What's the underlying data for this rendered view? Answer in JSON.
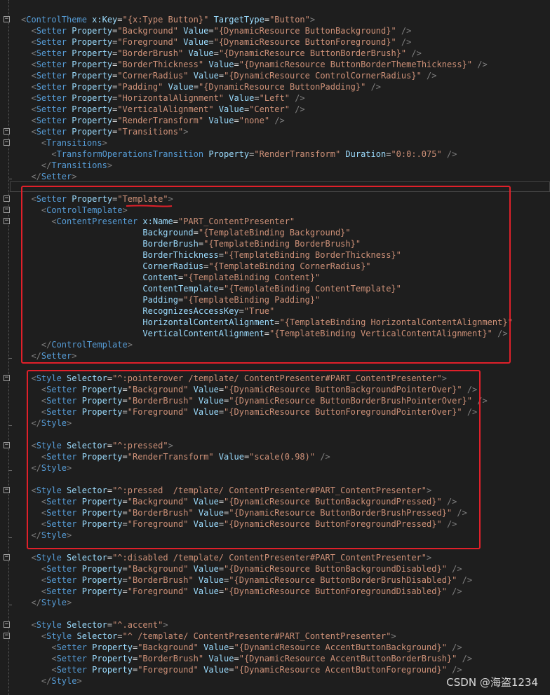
{
  "lines": [
    [
      [
        "b",
        "<"
      ],
      [
        "t",
        "ControlTheme"
      ],
      [
        "a",
        " x:Key"
      ],
      [
        "q",
        "="
      ],
      [
        "v",
        "\"{x:Type Button}\""
      ],
      [
        "a",
        " TargetType"
      ],
      [
        "q",
        "="
      ],
      [
        "v",
        "\"Button\""
      ],
      [
        "b",
        ">"
      ]
    ],
    [
      [
        "b",
        "  <"
      ],
      [
        "t",
        "Setter"
      ],
      [
        "a",
        " Property"
      ],
      [
        "q",
        "="
      ],
      [
        "v",
        "\"Background\""
      ],
      [
        "a",
        " Value"
      ],
      [
        "q",
        "="
      ],
      [
        "v",
        "\"{DynamicResource ButtonBackground}\""
      ],
      [
        "b",
        " />"
      ]
    ],
    [
      [
        "b",
        "  <"
      ],
      [
        "t",
        "Setter"
      ],
      [
        "a",
        " Property"
      ],
      [
        "q",
        "="
      ],
      [
        "v",
        "\"Foreground\""
      ],
      [
        "a",
        " Value"
      ],
      [
        "q",
        "="
      ],
      [
        "v",
        "\"{DynamicResource ButtonForeground}\""
      ],
      [
        "b",
        " />"
      ]
    ],
    [
      [
        "b",
        "  <"
      ],
      [
        "t",
        "Setter"
      ],
      [
        "a",
        " Property"
      ],
      [
        "q",
        "="
      ],
      [
        "v",
        "\"BorderBrush\""
      ],
      [
        "a",
        " Value"
      ],
      [
        "q",
        "="
      ],
      [
        "v",
        "\"{DynamicResource ButtonBorderBrush}\""
      ],
      [
        "b",
        " />"
      ]
    ],
    [
      [
        "b",
        "  <"
      ],
      [
        "t",
        "Setter"
      ],
      [
        "a",
        " Property"
      ],
      [
        "q",
        "="
      ],
      [
        "v",
        "\"BorderThickness\""
      ],
      [
        "a",
        " Value"
      ],
      [
        "q",
        "="
      ],
      [
        "v",
        "\"{DynamicResource ButtonBorderThemeThickness}\""
      ],
      [
        "b",
        " />"
      ]
    ],
    [
      [
        "b",
        "  <"
      ],
      [
        "t",
        "Setter"
      ],
      [
        "a",
        " Property"
      ],
      [
        "q",
        "="
      ],
      [
        "v",
        "\"CornerRadius\""
      ],
      [
        "a",
        " Value"
      ],
      [
        "q",
        "="
      ],
      [
        "v",
        "\"{DynamicResource ControlCornerRadius}\""
      ],
      [
        "b",
        " />"
      ]
    ],
    [
      [
        "b",
        "  <"
      ],
      [
        "t",
        "Setter"
      ],
      [
        "a",
        " Property"
      ],
      [
        "q",
        "="
      ],
      [
        "v",
        "\"Padding\""
      ],
      [
        "a",
        " Value"
      ],
      [
        "q",
        "="
      ],
      [
        "v",
        "\"{DynamicResource ButtonPadding}\""
      ],
      [
        "b",
        " />"
      ]
    ],
    [
      [
        "b",
        "  <"
      ],
      [
        "t",
        "Setter"
      ],
      [
        "a",
        " Property"
      ],
      [
        "q",
        "="
      ],
      [
        "v",
        "\"HorizontalAlignment\""
      ],
      [
        "a",
        " Value"
      ],
      [
        "q",
        "="
      ],
      [
        "v",
        "\"Left\""
      ],
      [
        "b",
        " />"
      ]
    ],
    [
      [
        "b",
        "  <"
      ],
      [
        "t",
        "Setter"
      ],
      [
        "a",
        " Property"
      ],
      [
        "q",
        "="
      ],
      [
        "v",
        "\"VerticalAlignment\""
      ],
      [
        "a",
        " Value"
      ],
      [
        "q",
        "="
      ],
      [
        "v",
        "\"Center\""
      ],
      [
        "b",
        " />"
      ]
    ],
    [
      [
        "b",
        "  <"
      ],
      [
        "t",
        "Setter"
      ],
      [
        "a",
        " Property"
      ],
      [
        "q",
        "="
      ],
      [
        "v",
        "\"RenderTransform\""
      ],
      [
        "a",
        " Value"
      ],
      [
        "q",
        "="
      ],
      [
        "v",
        "\"none\""
      ],
      [
        "b",
        " />"
      ]
    ],
    [
      [
        "b",
        "  <"
      ],
      [
        "t",
        "Setter"
      ],
      [
        "a",
        " Property"
      ],
      [
        "q",
        "="
      ],
      [
        "v",
        "\"Transitions\""
      ],
      [
        "b",
        ">"
      ]
    ],
    [
      [
        "b",
        "    <"
      ],
      [
        "t",
        "Transitions"
      ],
      [
        "b",
        ">"
      ]
    ],
    [
      [
        "b",
        "      <"
      ],
      [
        "t",
        "TransformOperationsTransition"
      ],
      [
        "a",
        " Property"
      ],
      [
        "q",
        "="
      ],
      [
        "v",
        "\"RenderTransform\""
      ],
      [
        "a",
        " Duration"
      ],
      [
        "q",
        "="
      ],
      [
        "v",
        "\"0:0:.075\""
      ],
      [
        "b",
        " />"
      ]
    ],
    [
      [
        "b",
        "    </"
      ],
      [
        "t",
        "Transitions"
      ],
      [
        "b",
        ">"
      ]
    ],
    [
      [
        "b",
        "  </"
      ],
      [
        "t",
        "Setter"
      ],
      [
        "b",
        ">"
      ]
    ],
    [],
    [
      [
        "b",
        "  <"
      ],
      [
        "t",
        "Setter"
      ],
      [
        "a",
        " Property"
      ],
      [
        "q",
        "="
      ],
      [
        "v",
        "\"Template\""
      ],
      [
        "b",
        ">"
      ]
    ],
    [
      [
        "b",
        "    <"
      ],
      [
        "t",
        "ControlTemplate"
      ],
      [
        "b",
        ">"
      ]
    ],
    [
      [
        "b",
        "      <"
      ],
      [
        "t",
        "ContentPresenter"
      ],
      [
        "a",
        " x:Name"
      ],
      [
        "q",
        "="
      ],
      [
        "v",
        "\"PART_ContentPresenter\""
      ]
    ],
    [
      [
        "a",
        "                        Background"
      ],
      [
        "q",
        "="
      ],
      [
        "v",
        "\"{TemplateBinding Background}\""
      ]
    ],
    [
      [
        "a",
        "                        BorderBrush"
      ],
      [
        "q",
        "="
      ],
      [
        "v",
        "\"{TemplateBinding BorderBrush}\""
      ]
    ],
    [
      [
        "a",
        "                        BorderThickness"
      ],
      [
        "q",
        "="
      ],
      [
        "v",
        "\"{TemplateBinding BorderThickness}\""
      ]
    ],
    [
      [
        "a",
        "                        CornerRadius"
      ],
      [
        "q",
        "="
      ],
      [
        "v",
        "\"{TemplateBinding CornerRadius}\""
      ]
    ],
    [
      [
        "a",
        "                        Content"
      ],
      [
        "q",
        "="
      ],
      [
        "v",
        "\"{TemplateBinding Content}\""
      ]
    ],
    [
      [
        "a",
        "                        ContentTemplate"
      ],
      [
        "q",
        "="
      ],
      [
        "v",
        "\"{TemplateBinding ContentTemplate}\""
      ]
    ],
    [
      [
        "a",
        "                        Padding"
      ],
      [
        "q",
        "="
      ],
      [
        "v",
        "\"{TemplateBinding Padding}\""
      ]
    ],
    [
      [
        "a",
        "                        RecognizesAccessKey"
      ],
      [
        "q",
        "="
      ],
      [
        "v",
        "\"True\""
      ]
    ],
    [
      [
        "a",
        "                        HorizontalContentAlignment"
      ],
      [
        "q",
        "="
      ],
      [
        "v",
        "\"{TemplateBinding HorizontalContentAlignment}\""
      ]
    ],
    [
      [
        "a",
        "                        VerticalContentAlignment"
      ],
      [
        "q",
        "="
      ],
      [
        "v",
        "\"{TemplateBinding VerticalContentAlignment}\""
      ],
      [
        "b",
        " />"
      ]
    ],
    [
      [
        "b",
        "    </"
      ],
      [
        "t",
        "ControlTemplate"
      ],
      [
        "b",
        ">"
      ]
    ],
    [
      [
        "b",
        "  </"
      ],
      [
        "t",
        "Setter"
      ],
      [
        "b",
        ">"
      ]
    ],
    [],
    [
      [
        "b",
        "  <"
      ],
      [
        "t",
        "Style"
      ],
      [
        "a",
        " Selector"
      ],
      [
        "q",
        "="
      ],
      [
        "v",
        "\"^:pointerover /template/ ContentPresenter#PART_ContentPresenter\""
      ],
      [
        "b",
        ">"
      ]
    ],
    [
      [
        "b",
        "    <"
      ],
      [
        "t",
        "Setter"
      ],
      [
        "a",
        " Property"
      ],
      [
        "q",
        "="
      ],
      [
        "v",
        "\"Background\""
      ],
      [
        "a",
        " Value"
      ],
      [
        "q",
        "="
      ],
      [
        "v",
        "\"{DynamicResource ButtonBackgroundPointerOver}\""
      ],
      [
        "b",
        " />"
      ]
    ],
    [
      [
        "b",
        "    <"
      ],
      [
        "t",
        "Setter"
      ],
      [
        "a",
        " Property"
      ],
      [
        "q",
        "="
      ],
      [
        "v",
        "\"BorderBrush\""
      ],
      [
        "a",
        " Value"
      ],
      [
        "q",
        "="
      ],
      [
        "v",
        "\"{DynamicResource ButtonBorderBrushPointerOver}\""
      ],
      [
        "b",
        " />"
      ]
    ],
    [
      [
        "b",
        "    <"
      ],
      [
        "t",
        "Setter"
      ],
      [
        "a",
        " Property"
      ],
      [
        "q",
        "="
      ],
      [
        "v",
        "\"Foreground\""
      ],
      [
        "a",
        " Value"
      ],
      [
        "q",
        "="
      ],
      [
        "v",
        "\"{DynamicResource ButtonForegroundPointerOver}\""
      ],
      [
        "b",
        " />"
      ]
    ],
    [
      [
        "b",
        "  </"
      ],
      [
        "t",
        "Style"
      ],
      [
        "b",
        ">"
      ]
    ],
    [],
    [
      [
        "b",
        "  <"
      ],
      [
        "t",
        "Style"
      ],
      [
        "a",
        " Selector"
      ],
      [
        "q",
        "="
      ],
      [
        "v",
        "\"^:pressed\""
      ],
      [
        "b",
        ">"
      ]
    ],
    [
      [
        "b",
        "    <"
      ],
      [
        "t",
        "Setter"
      ],
      [
        "a",
        " Property"
      ],
      [
        "q",
        "="
      ],
      [
        "v",
        "\"RenderTransform\""
      ],
      [
        "a",
        " Value"
      ],
      [
        "q",
        "="
      ],
      [
        "v",
        "\"scale(0.98)\""
      ],
      [
        "b",
        " />"
      ]
    ],
    [
      [
        "b",
        "  </"
      ],
      [
        "t",
        "Style"
      ],
      [
        "b",
        ">"
      ]
    ],
    [],
    [
      [
        "b",
        "  <"
      ],
      [
        "t",
        "Style"
      ],
      [
        "a",
        " Selector"
      ],
      [
        "q",
        "="
      ],
      [
        "v",
        "\"^:pressed  /template/ ContentPresenter#PART_ContentPresenter\""
      ],
      [
        "b",
        ">"
      ]
    ],
    [
      [
        "b",
        "    <"
      ],
      [
        "t",
        "Setter"
      ],
      [
        "a",
        " Property"
      ],
      [
        "q",
        "="
      ],
      [
        "v",
        "\"Background\""
      ],
      [
        "a",
        " Value"
      ],
      [
        "q",
        "="
      ],
      [
        "v",
        "\"{DynamicResource ButtonBackgroundPressed}\""
      ],
      [
        "b",
        " />"
      ]
    ],
    [
      [
        "b",
        "    <"
      ],
      [
        "t",
        "Setter"
      ],
      [
        "a",
        " Property"
      ],
      [
        "q",
        "="
      ],
      [
        "v",
        "\"BorderBrush\""
      ],
      [
        "a",
        " Value"
      ],
      [
        "q",
        "="
      ],
      [
        "v",
        "\"{DynamicResource ButtonBorderBrushPressed}\""
      ],
      [
        "b",
        " />"
      ]
    ],
    [
      [
        "b",
        "    <"
      ],
      [
        "t",
        "Setter"
      ],
      [
        "a",
        " Property"
      ],
      [
        "q",
        "="
      ],
      [
        "v",
        "\"Foreground\""
      ],
      [
        "a",
        " Value"
      ],
      [
        "q",
        "="
      ],
      [
        "v",
        "\"{DynamicResource ButtonForegroundPressed}\""
      ],
      [
        "b",
        " />"
      ]
    ],
    [
      [
        "b",
        "  </"
      ],
      [
        "t",
        "Style"
      ],
      [
        "b",
        ">"
      ]
    ],
    [],
    [
      [
        "b",
        "  <"
      ],
      [
        "t",
        "Style"
      ],
      [
        "a",
        " Selector"
      ],
      [
        "q",
        "="
      ],
      [
        "v",
        "\"^:disabled /template/ ContentPresenter#PART_ContentPresenter\""
      ],
      [
        "b",
        ">"
      ]
    ],
    [
      [
        "b",
        "    <"
      ],
      [
        "t",
        "Setter"
      ],
      [
        "a",
        " Property"
      ],
      [
        "q",
        "="
      ],
      [
        "v",
        "\"Background\""
      ],
      [
        "a",
        " Value"
      ],
      [
        "q",
        "="
      ],
      [
        "v",
        "\"{DynamicResource ButtonBackgroundDisabled}\""
      ],
      [
        "b",
        " />"
      ]
    ],
    [
      [
        "b",
        "    <"
      ],
      [
        "t",
        "Setter"
      ],
      [
        "a",
        " Property"
      ],
      [
        "q",
        "="
      ],
      [
        "v",
        "\"BorderBrush\""
      ],
      [
        "a",
        " Value"
      ],
      [
        "q",
        "="
      ],
      [
        "v",
        "\"{DynamicResource ButtonBorderBrushDisabled}\""
      ],
      [
        "b",
        " />"
      ]
    ],
    [
      [
        "b",
        "    <"
      ],
      [
        "t",
        "Setter"
      ],
      [
        "a",
        " Property"
      ],
      [
        "q",
        "="
      ],
      [
        "v",
        "\"Foreground\""
      ],
      [
        "a",
        " Value"
      ],
      [
        "q",
        "="
      ],
      [
        "v",
        "\"{DynamicResource ButtonForegroundDisabled}\""
      ],
      [
        "b",
        " />"
      ]
    ],
    [
      [
        "b",
        "  </"
      ],
      [
        "t",
        "Style"
      ],
      [
        "b",
        ">"
      ]
    ],
    [],
    [
      [
        "b",
        "  <"
      ],
      [
        "t",
        "Style"
      ],
      [
        "a",
        " Selector"
      ],
      [
        "q",
        "="
      ],
      [
        "v",
        "\"^.accent\""
      ],
      [
        "b",
        ">"
      ]
    ],
    [
      [
        "b",
        "    <"
      ],
      [
        "t",
        "Style"
      ],
      [
        "a",
        " Selector"
      ],
      [
        "q",
        "="
      ],
      [
        "v",
        "\"^ /template/ ContentPresenter#PART_ContentPresenter\""
      ],
      [
        "b",
        ">"
      ]
    ],
    [
      [
        "b",
        "      <"
      ],
      [
        "t",
        "Setter"
      ],
      [
        "a",
        " Property"
      ],
      [
        "q",
        "="
      ],
      [
        "v",
        "\"Background\""
      ],
      [
        "a",
        " Value"
      ],
      [
        "q",
        "="
      ],
      [
        "v",
        "\"{DynamicResource AccentButtonBackground}\""
      ],
      [
        "b",
        " />"
      ]
    ],
    [
      [
        "b",
        "      <"
      ],
      [
        "t",
        "Setter"
      ],
      [
        "a",
        " Property"
      ],
      [
        "q",
        "="
      ],
      [
        "v",
        "\"BorderBrush\""
      ],
      [
        "a",
        " Value"
      ],
      [
        "q",
        "="
      ],
      [
        "v",
        "\"{DynamicResource AccentButtonBorderBrush}\""
      ],
      [
        "b",
        " />"
      ]
    ],
    [
      [
        "b",
        "      <"
      ],
      [
        "t",
        "Setter"
      ],
      [
        "a",
        " Property"
      ],
      [
        "q",
        "="
      ],
      [
        "v",
        "\"Foreground\""
      ],
      [
        "a",
        " Value"
      ],
      [
        "q",
        "="
      ],
      [
        "v",
        "\"{DynamicResource AccentButtonForeground}\""
      ],
      [
        "b",
        " />"
      ]
    ],
    [
      [
        "b",
        "    </"
      ],
      [
        "t",
        "Style"
      ],
      [
        "b",
        ">"
      ]
    ]
  ],
  "folds": [
    0,
    10,
    11,
    16,
    17,
    18,
    32,
    38,
    42,
    48,
    54,
    55
  ],
  "watermark": "CSDN @海盗1234",
  "colors": {
    "background": "#1e1e1e",
    "tag": "#569cd6",
    "attribute": "#9cdcfe",
    "value": "#ce9178",
    "bracket": "#808080",
    "highlight": "#e0202a"
  }
}
